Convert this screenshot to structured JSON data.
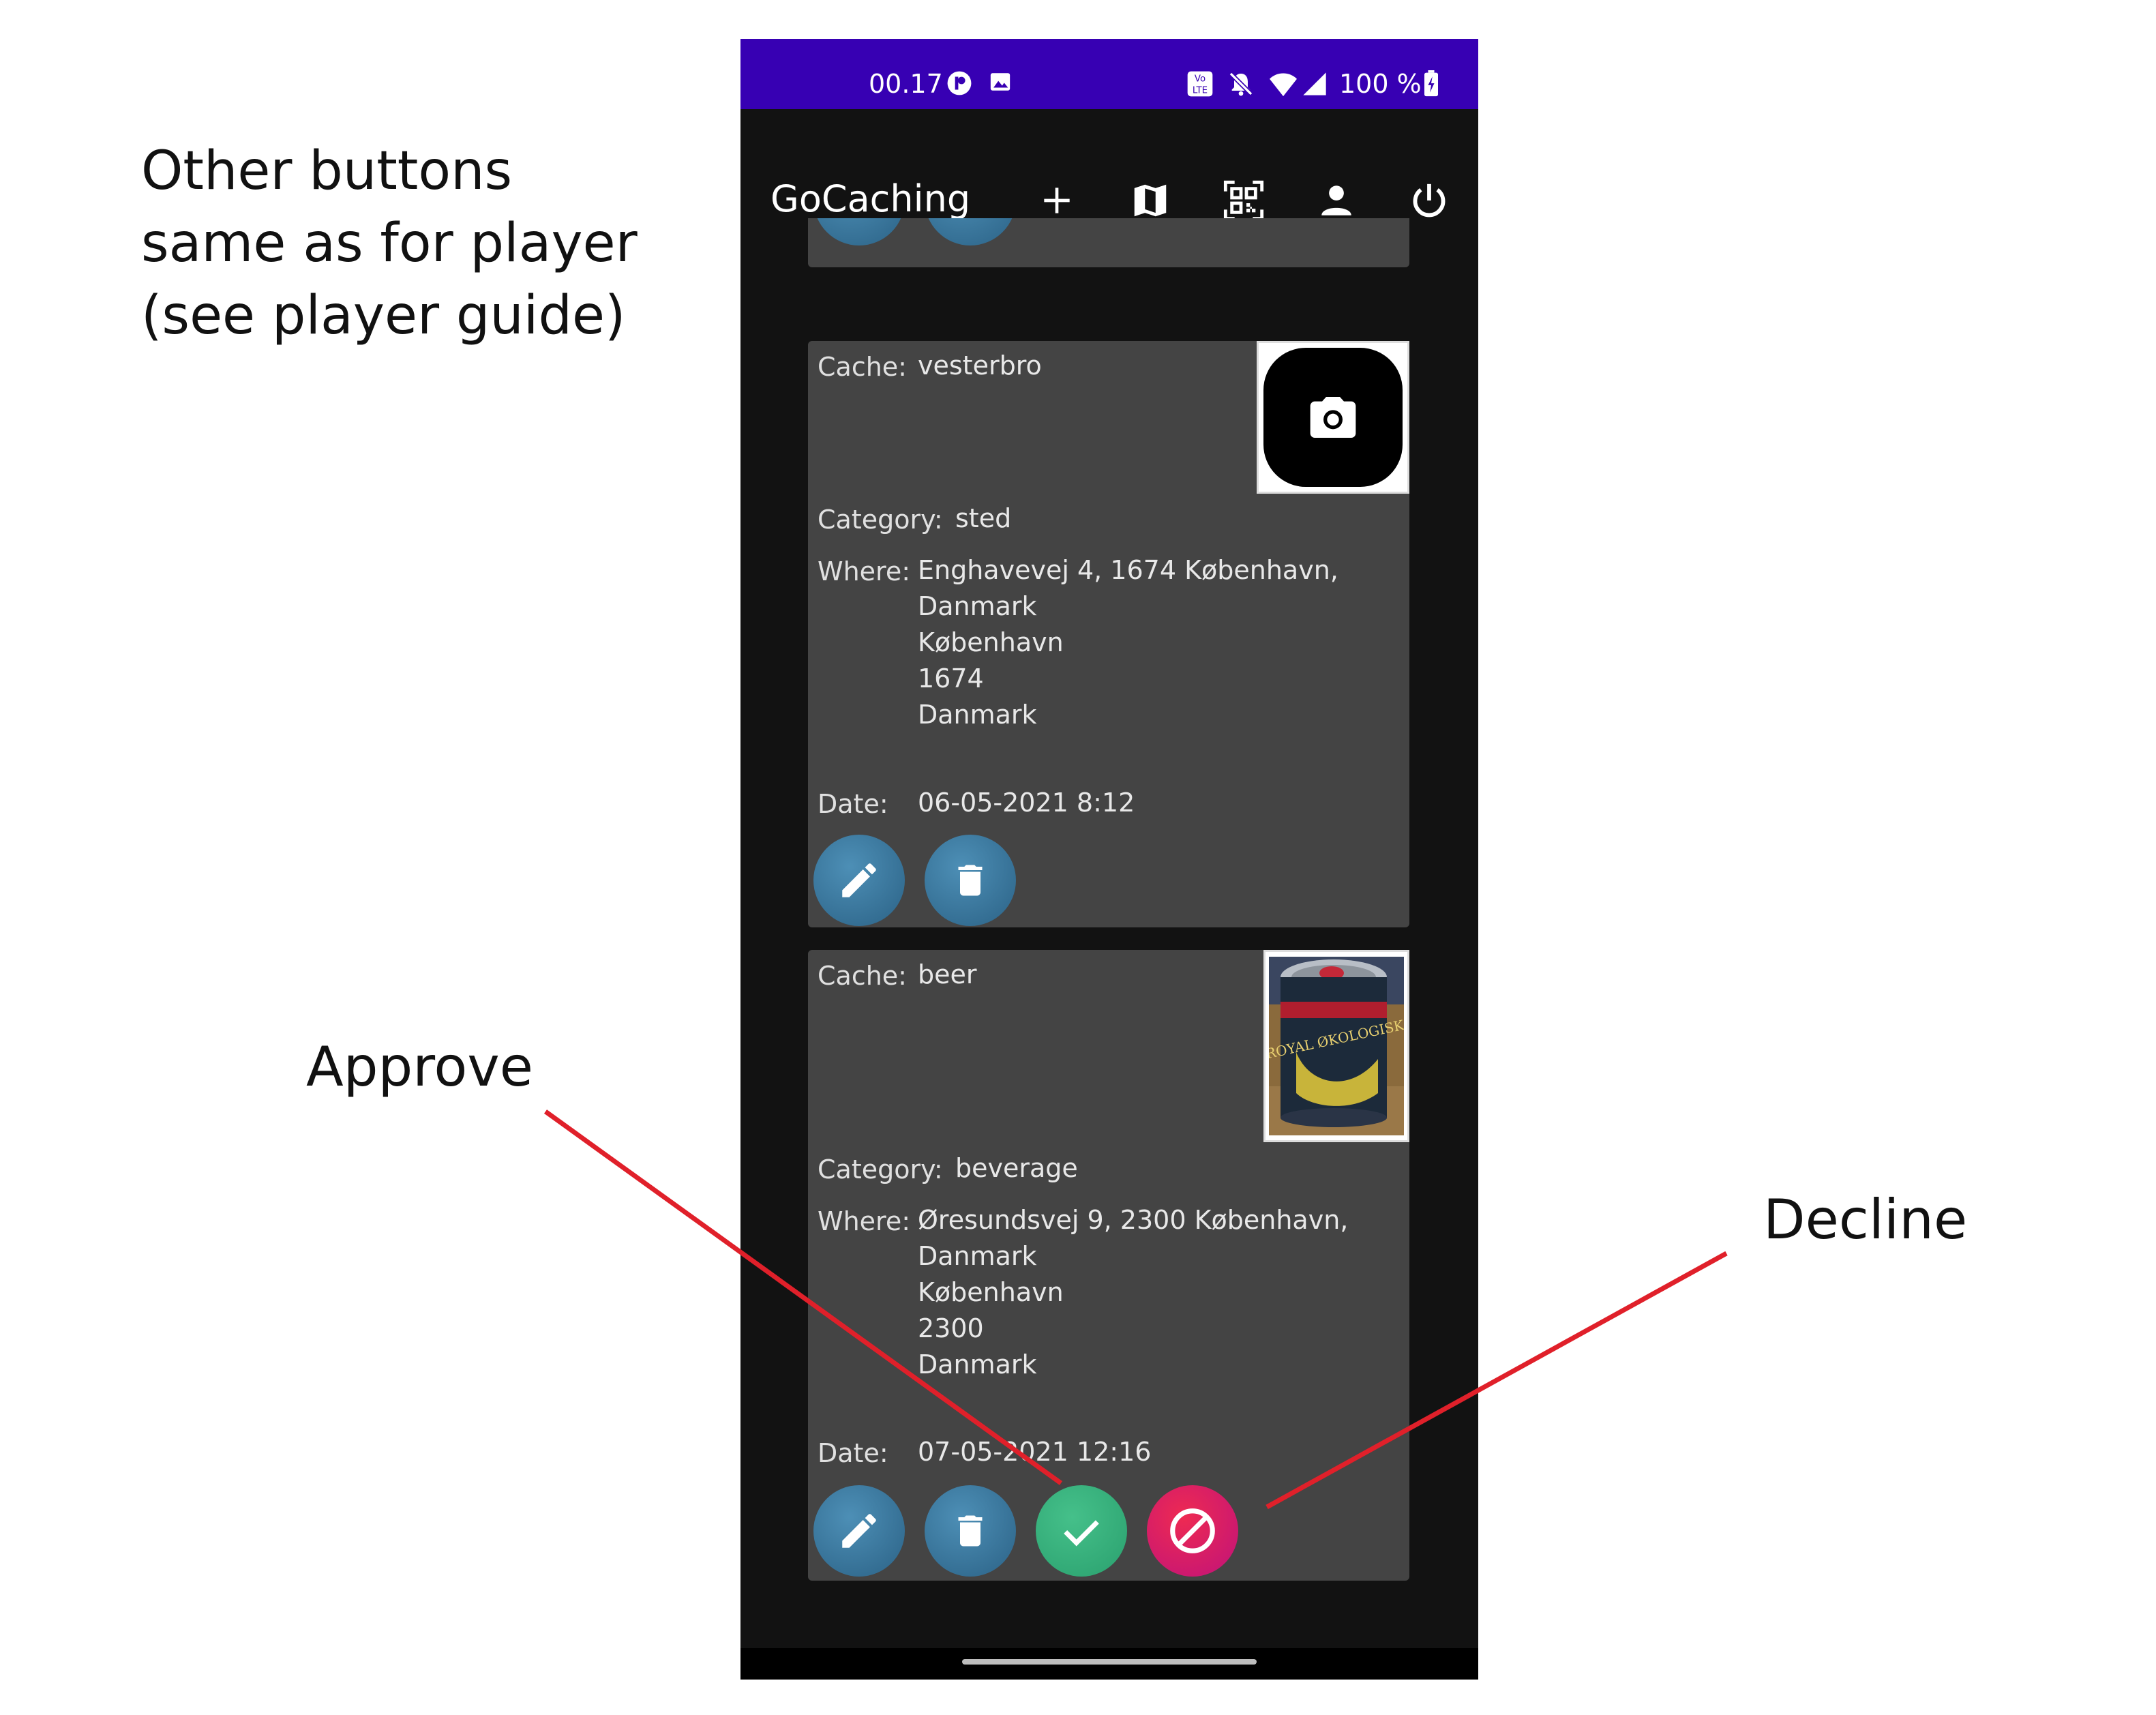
{
  "annotations": {
    "other_buttons_note": "Other buttons same as for player (see player guide)",
    "approve_label": "Approve",
    "decline_label": "Decline",
    "arrow_color": "#e0202a"
  },
  "status_bar": {
    "time": "00.17",
    "battery_text": "100 %",
    "background_color": "#3700b3",
    "icons": [
      "app-notification-icon",
      "image-icon",
      "volte-icon",
      "mute-icon",
      "wifi-icon",
      "signal-icon",
      "battery-icon"
    ]
  },
  "app_bar": {
    "title": "GoCaching",
    "actions": [
      "add-icon",
      "map-icon",
      "qr-scan-icon",
      "profile-icon",
      "power-icon"
    ]
  },
  "cards": [
    {
      "cache_label": "Cache:",
      "cache": "vesterbro",
      "category_label": "Category:",
      "category": "sted",
      "where_label": "Where:",
      "address_lines": [
        "Enghavevej 4, 1674 København, Danmark",
        "København",
        "1674",
        "Danmark"
      ],
      "date_label": "Date:",
      "date": "06-05-2021 8:12",
      "image": "camera-placeholder-icon",
      "buttons": [
        "edit",
        "delete"
      ]
    },
    {
      "cache_label": "Cache:",
      "cache": "beer",
      "category_label": "Category:",
      "category": "beverage",
      "where_label": "Where:",
      "address_lines": [
        "Øresundsvej 9, 2300 København,",
        "Danmark",
        "København",
        "2300",
        "Danmark"
      ],
      "date_label": "Date:",
      "date": "07-05-2021 12:16",
      "image": "beer-can-photo",
      "can_text": "ROYAL ØKOLOGISK",
      "buttons": [
        "edit",
        "delete",
        "approve",
        "decline"
      ]
    }
  ]
}
